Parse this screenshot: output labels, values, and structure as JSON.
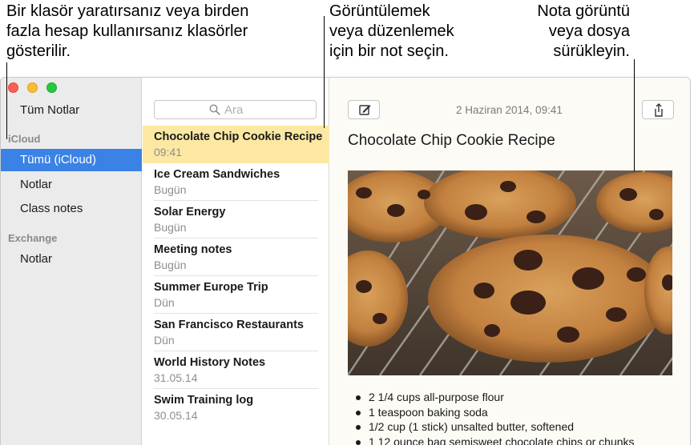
{
  "callouts": {
    "left": [
      "Bir klasör yaratırsanız veya birden",
      "fazla hesap kullanırsanız klasörler",
      "gösterilir."
    ],
    "middle": [
      "Görüntülemek",
      "veya düzenlemek",
      "için bir not seçin."
    ],
    "right": [
      "Nota görüntü",
      "veya dosya",
      "sürükleyin."
    ]
  },
  "sidebar": {
    "all_notes": "Tüm Notlar",
    "icloud_header": "iCloud",
    "icloud_items": [
      "Tümü (iCloud)",
      "Notlar",
      "Class notes"
    ],
    "exchange_header": "Exchange",
    "exchange_items": [
      "Notlar"
    ],
    "selected_color": "#3b82e6"
  },
  "search": {
    "placeholder": "Ara"
  },
  "notes": [
    {
      "title": "Chocolate Chip Cookie Recipe",
      "date": "09:41"
    },
    {
      "title": "Ice Cream Sandwiches",
      "date": "Bugün"
    },
    {
      "title": "Solar Energy",
      "date": "Bugün"
    },
    {
      "title": "Meeting notes",
      "date": "Bugün"
    },
    {
      "title": "Summer Europe Trip",
      "date": "Dün"
    },
    {
      "title": "San Francisco Restaurants",
      "date": "Dün"
    },
    {
      "title": "World History Notes",
      "date": "31.05.14"
    },
    {
      "title": "Swim Training log",
      "date": "30.05.14"
    }
  ],
  "editor": {
    "timestamp": "2 Haziran 2014, 09:41",
    "title": "Chocolate Chip Cookie Recipe",
    "ingredients": [
      "2 1/4 cups all-purpose flour",
      "1 teaspoon baking soda",
      "1/2 cup (1 stick) unsalted butter, softened",
      "1 12 ounce bag semisweet chocolate chips or chunks"
    ]
  },
  "icons": {
    "compose": "compose-icon",
    "share": "share-icon",
    "search": "search-icon"
  }
}
